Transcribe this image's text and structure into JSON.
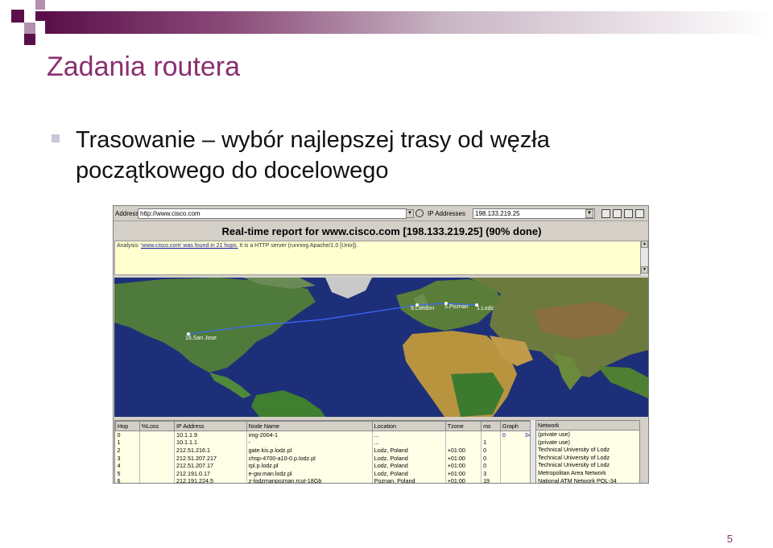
{
  "slide": {
    "title": "Zadania routera",
    "bullet": "Trasowanie – wybór najlepszej trasy od węzła początkowego do docelowego",
    "page_number": "5"
  },
  "colors": {
    "title": "#8a2f6f",
    "accent_dark": "#5a0f4a",
    "map_ocean": "#1e2f7a",
    "route_line": "#3a6bff"
  },
  "screenshot": {
    "address_label": "Address",
    "address_value": "http://www.cisco.com",
    "ip_label": "IP Addresses",
    "ip_value": "198.133.219.25",
    "report_title": "Real-time report for www.cisco.com [198.133.219.25] (90% done)",
    "analysis_prefix": "Analysis:",
    "analysis_link": "'www.cisco.com' was found in 21 hops.",
    "analysis_rest": "It is a HTTP server (running Apache/1.0 [Unix]).",
    "map_labels": {
      "london": "9.London",
      "poznan": "5.Poznan",
      "lodz": "1.Lodz",
      "san_jose": "16.San Jose"
    },
    "table": {
      "headers": [
        "Hop",
        "%Loss",
        "IP Address",
        "Node Name",
        "Location",
        "Tzone",
        "ms",
        "Graph"
      ],
      "rows": [
        [
          "0",
          "",
          "10.1.1.9",
          "img-2004-1",
          "...",
          "",
          "",
          "0"
        ],
        [
          "1",
          "",
          "10.1.1.1",
          "-",
          "...",
          "",
          "1",
          ""
        ],
        [
          "2",
          "",
          "212.51.216.1",
          "gate.kis.p.lodz.pl",
          "Lodz, Poland",
          "+01:00",
          "0",
          ""
        ],
        [
          "3",
          "",
          "212.51.207.217",
          "chsp-4700-a10-0.p.lodz.pl",
          "Lodz, Poland",
          "+01:00",
          "0",
          ""
        ],
        [
          "4",
          "",
          "212.51.207.17",
          "rpl.p.lodz.pl",
          "Lodz, Poland",
          "+01:00",
          "0",
          ""
        ],
        [
          "5",
          "",
          "212.191.0.17",
          "e-gw.man.lodz.pl",
          "Lodz, Poland",
          "+01:00",
          "3",
          ""
        ],
        [
          "6",
          "",
          "212.191.224.5",
          "z-lodzmanpoznan.rcut-18Gb",
          "Poznan, Poland",
          "+01:00",
          "19",
          ""
        ]
      ],
      "graph_scale_max": "34"
    },
    "network": {
      "header": "Network",
      "rows": [
        "(private use)",
        "(private use)",
        "Technical University of Lodz",
        "Technical University of Lodz",
        "Technical University of Lodz",
        "Metropolitan Area Network",
        "National ATM Network POL-34"
      ]
    }
  }
}
